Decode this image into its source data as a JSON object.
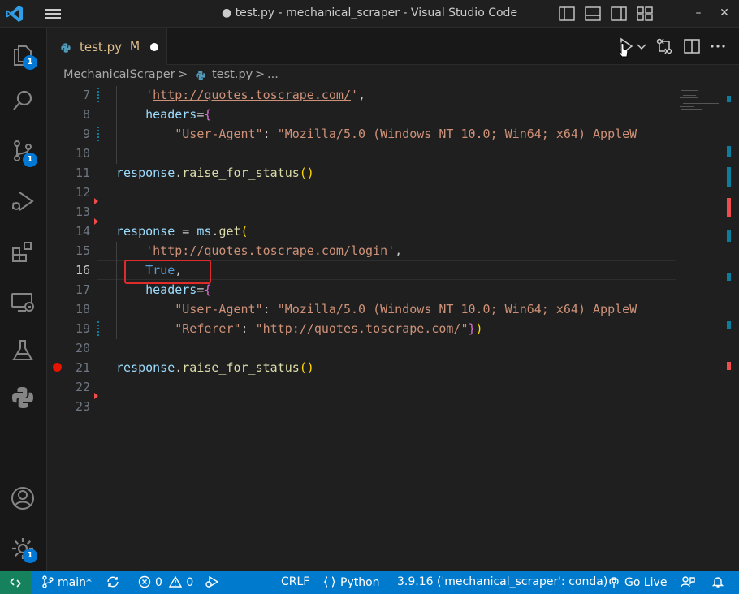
{
  "window": {
    "title": "● test.py - mechanical_scraper - Visual Studio Code",
    "minimize": "–",
    "maximize": "☐",
    "close": "✕"
  },
  "activity_bar": {
    "explorer_badge": "1",
    "source_control_badge": "1",
    "manage_badge": "1"
  },
  "tab": {
    "filename": "test.py",
    "status": "M"
  },
  "breadcrumb": {
    "folder": "MechanicalScraper",
    "sep": ">",
    "file": "test.py",
    "tail": "..."
  },
  "editor": {
    "lines": [
      {
        "n": "7"
      },
      {
        "n": "8"
      },
      {
        "n": "9"
      },
      {
        "n": "10"
      },
      {
        "n": "11"
      },
      {
        "n": "12"
      },
      {
        "n": "13"
      },
      {
        "n": "14"
      },
      {
        "n": "15"
      },
      {
        "n": "16"
      },
      {
        "n": "17"
      },
      {
        "n": "18"
      },
      {
        "n": "19"
      },
      {
        "n": "20"
      },
      {
        "n": "21"
      },
      {
        "n": "22"
      },
      {
        "n": "23"
      }
    ],
    "code": {
      "l7_url": "http://quotes.toscrape.com/",
      "q": "'",
      "comma": ",",
      "headers": "headers",
      "eq": "=",
      "lbrace": "{",
      "rbrace": "}",
      "rparen": ")",
      "ua_key": "\"User-Agent\"",
      "colon": ": ",
      "ua_val": "\"Mozilla/5.0 (Windows NT 10.0; Win64; x64) AppleW",
      "response": "response",
      "dot": ".",
      "raise": "raise_for_status",
      "parens": "()",
      "assign": " = ",
      "ms": "ms",
      "get": "get",
      "lparen": "(",
      "login_url": "http://quotes.toscrape.com/login",
      "true_kw": "True",
      "referer_key": "\"Referer\"",
      "dq": "\"",
      "referer_url": "http://quotes.toscrape.com/"
    },
    "current_line": "16"
  },
  "status_bar": {
    "branch": "main*",
    "errors": "0",
    "warnings": "0",
    "eol": "CRLF",
    "language": "Python",
    "interpreter": "3.9.16 ('mechanical_scraper': conda)",
    "go_live": "Go Live"
  },
  "colors": {
    "accent": "#007acc",
    "remote": "#16825d",
    "highlight_box": "#e02b2b",
    "breakpoint": "#e51400"
  }
}
